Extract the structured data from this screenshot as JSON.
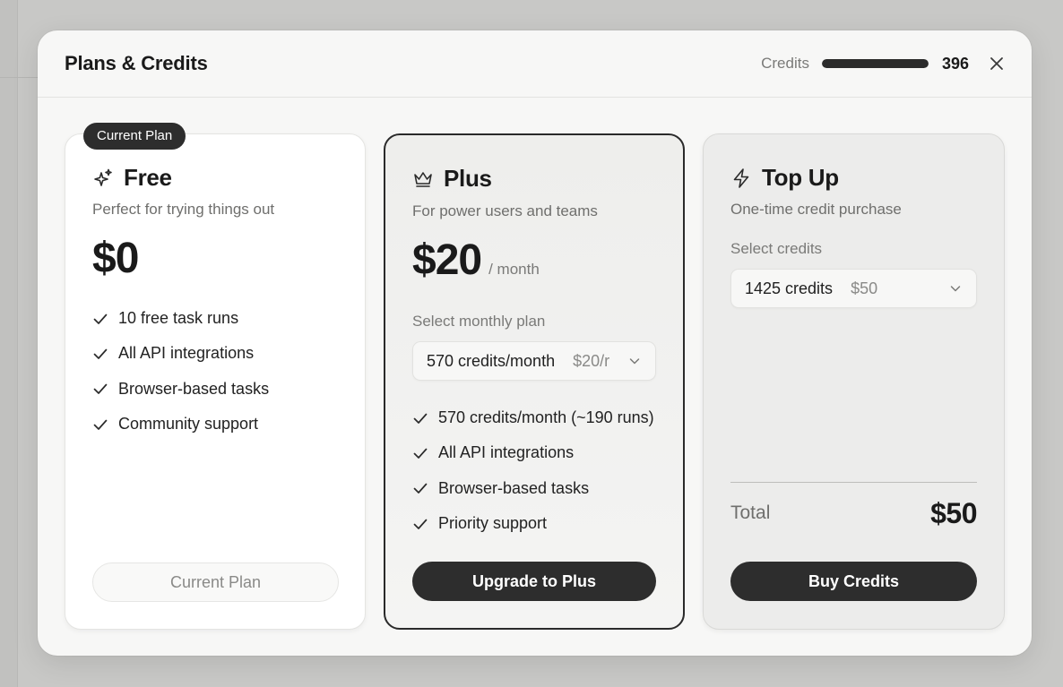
{
  "modal": {
    "title": "Plans & Credits",
    "credits_label": "Credits",
    "credits_count": "396",
    "credits_fill_fraction": 1.0,
    "close_icon": "close-icon"
  },
  "colors": {
    "accent_dark": "#2d2d2d",
    "backdrop": "#c8c8c6",
    "modal_bg": "#f7f7f6"
  },
  "plans": {
    "free": {
      "badge": "Current Plan",
      "icon": "sparkles-icon",
      "name": "Free",
      "description": "Perfect for trying things out",
      "price": "$0",
      "features": [
        "10 free task runs",
        "All API integrations",
        "Browser-based tasks",
        "Community support"
      ],
      "button_label": "Current Plan"
    },
    "plus": {
      "icon": "crown-icon",
      "name": "Plus",
      "description": "For power users and teams",
      "price": "$20",
      "period": "/ month",
      "select_label": "Select monthly plan",
      "select_value": "570 credits/month",
      "select_price": "$20/r",
      "features": [
        "570 credits/month (~190 runs)",
        "All API integrations",
        "Browser-based tasks",
        "Priority support"
      ],
      "button_label": "Upgrade to Plus"
    },
    "topup": {
      "icon": "lightning-icon",
      "name": "Top Up",
      "description": "One-time credit purchase",
      "select_label": "Select credits",
      "select_value": "1425 credits",
      "select_price": "$50",
      "total_label": "Total",
      "total_value": "$50",
      "button_label": "Buy Credits"
    }
  }
}
